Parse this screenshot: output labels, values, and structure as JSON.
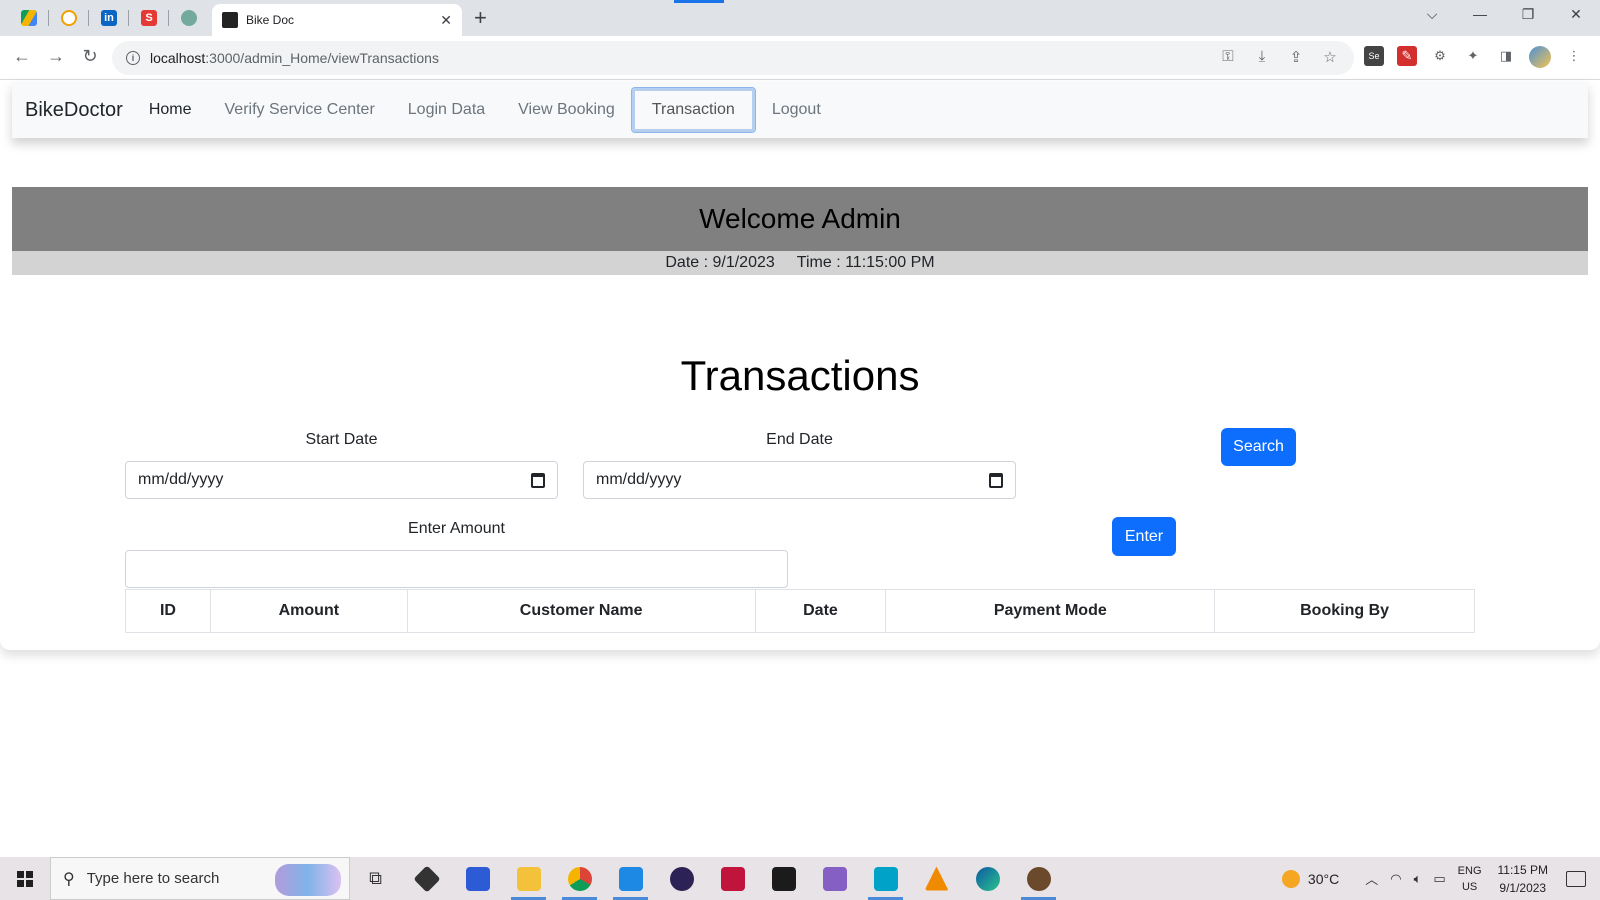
{
  "browser": {
    "active_tab_title": "Bike Doc",
    "url_host": "localhost",
    "url_path": ":3000/admin_Home/viewTransactions"
  },
  "navbar": {
    "brand": "BikeDoctor",
    "links": [
      {
        "label": "Home"
      },
      {
        "label": "Verify Service Center"
      },
      {
        "label": "Login Data"
      },
      {
        "label": "View Booking"
      },
      {
        "label": "Transaction"
      },
      {
        "label": "Logout"
      }
    ],
    "active_link": "Transaction"
  },
  "welcome": {
    "heading": "Welcome Admin",
    "date_text": "Date : 9/1/2023",
    "time_text": "Time : 11:15:00 PM"
  },
  "transactions": {
    "title": "Transactions",
    "start_date_label": "Start Date",
    "start_date_placeholder": "mm/dd/yyyy",
    "end_date_label": "End Date",
    "end_date_placeholder": "mm/dd/yyyy",
    "search_button": "Search",
    "amount_label": "Enter Amount",
    "amount_value": "",
    "enter_button": "Enter",
    "table_headers": [
      "ID",
      "Amount",
      "Customer Name",
      "Date",
      "Payment Mode",
      "Booking By"
    ]
  },
  "taskbar": {
    "search_placeholder": "Type here to search",
    "temperature": "30°C",
    "lang_line1": "ENG",
    "lang_line2": "US",
    "clock_time": "11:15 PM",
    "clock_date": "9/1/2023"
  },
  "colors": {
    "primary_button": "#0d6efd",
    "welcome_bar": "#808080",
    "datetime_bar": "#d3d3d3",
    "navbar_bg": "#f8f9fa"
  }
}
